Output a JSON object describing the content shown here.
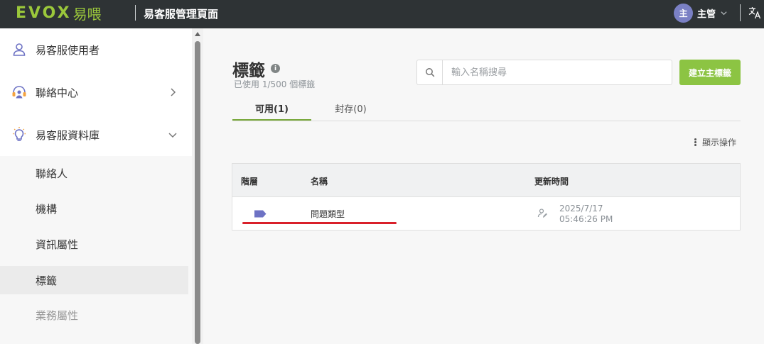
{
  "header": {
    "logo_text": "EVOX",
    "logo_cn": "易喂",
    "app_title": "易客服管理頁面",
    "user": {
      "avatar_text": "主",
      "name": "主管"
    }
  },
  "sidebar": {
    "items": [
      {
        "label": "易客服使用者"
      },
      {
        "label": "聯絡中心"
      },
      {
        "label": "易客服資料庫"
      }
    ],
    "sub_items": [
      {
        "label": "聯絡人"
      },
      {
        "label": "機構"
      },
      {
        "label": "資訊屬性"
      },
      {
        "label": "標籤"
      },
      {
        "label": "業務屬性"
      }
    ]
  },
  "main": {
    "title": "標籤",
    "usage": "已使用 1/500 個標籤",
    "search": {
      "placeholder": "輸入名稱搜尋"
    },
    "create_button": "建立主標籤",
    "tabs": [
      {
        "label": "可用(1)"
      },
      {
        "label": "封存(0)"
      }
    ],
    "show_actions": "顯示操作",
    "table": {
      "columns": [
        "階層",
        "名稱",
        "更新時間"
      ],
      "rows": [
        {
          "name": "問題類型",
          "date": "2025/7/17",
          "time": "05:46:26 PM"
        }
      ]
    }
  },
  "colors": {
    "topbar": "#2e3335",
    "accent_green": "#8cc443",
    "tag_icon": "#6d72c4",
    "avatar": "#7a80c4",
    "annotation_red": "#d9202a"
  }
}
